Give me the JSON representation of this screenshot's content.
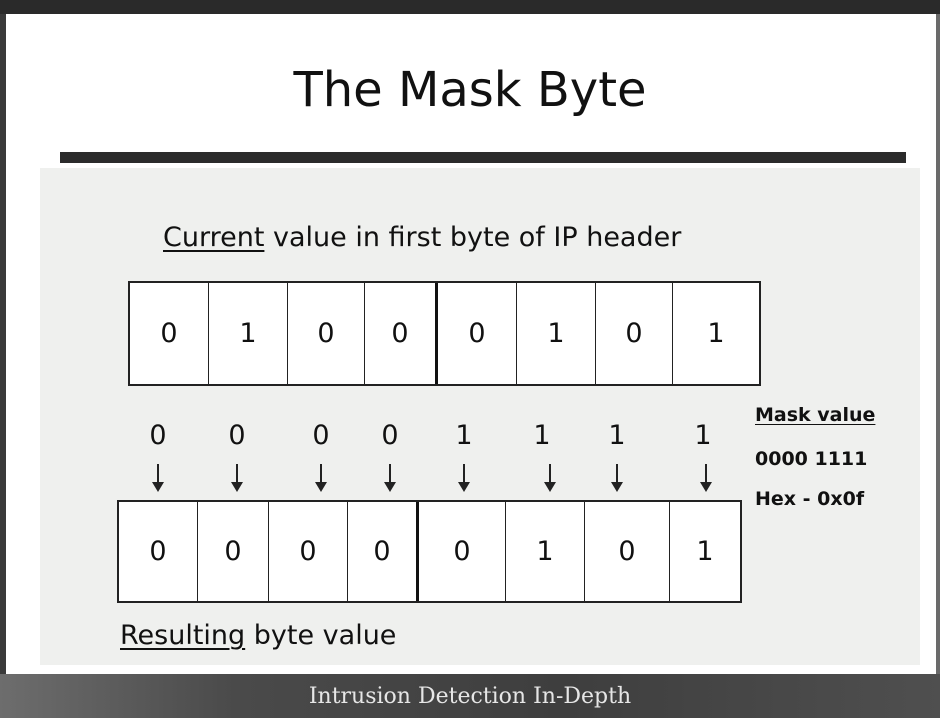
{
  "slide": {
    "title": "The Mask Byte",
    "footer": "Intrusion Detection In-Depth"
  },
  "current": {
    "label_underlined": "Current",
    "label_rest": " value in first byte of IP header",
    "bits": [
      "0",
      "1",
      "0",
      "0",
      "0",
      "1",
      "0",
      "1"
    ]
  },
  "mask": {
    "bits": [
      "0",
      "0",
      "0",
      "0",
      "1",
      "1",
      "1",
      "1"
    ],
    "heading": "Mask value",
    "binary": "0000 1111",
    "hex": "Hex - 0x0f"
  },
  "result": {
    "label_underlined": "Resulting",
    "label_rest": " byte value",
    "bits": [
      "0",
      "0",
      "0",
      "0",
      "0",
      "1",
      "0",
      "1"
    ]
  }
}
